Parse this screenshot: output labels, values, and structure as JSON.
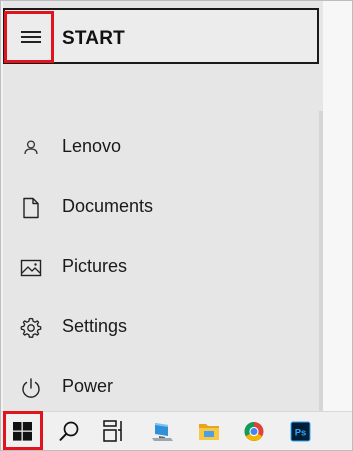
{
  "start_menu": {
    "title": "START",
    "items": [
      {
        "label": "Lenovo",
        "icon": "user-icon"
      },
      {
        "label": "Documents",
        "icon": "document-icon"
      },
      {
        "label": "Pictures",
        "icon": "pictures-icon"
      },
      {
        "label": "Settings",
        "icon": "settings-gear-icon"
      },
      {
        "label": "Power",
        "icon": "power-icon"
      }
    ]
  },
  "taskbar": {
    "items": [
      {
        "name": "windows-start-icon"
      },
      {
        "name": "search-icon"
      },
      {
        "name": "task-view-icon"
      },
      {
        "name": "this-pc-icon"
      },
      {
        "name": "file-explorer-icon"
      },
      {
        "name": "chrome-icon"
      },
      {
        "name": "photoshop-icon",
        "text": "Ps"
      }
    ]
  },
  "colors": {
    "highlight_red": "#e0141e",
    "panel_bg": "#e6e6e6",
    "taskbar_bg": "#f0f0f0"
  }
}
